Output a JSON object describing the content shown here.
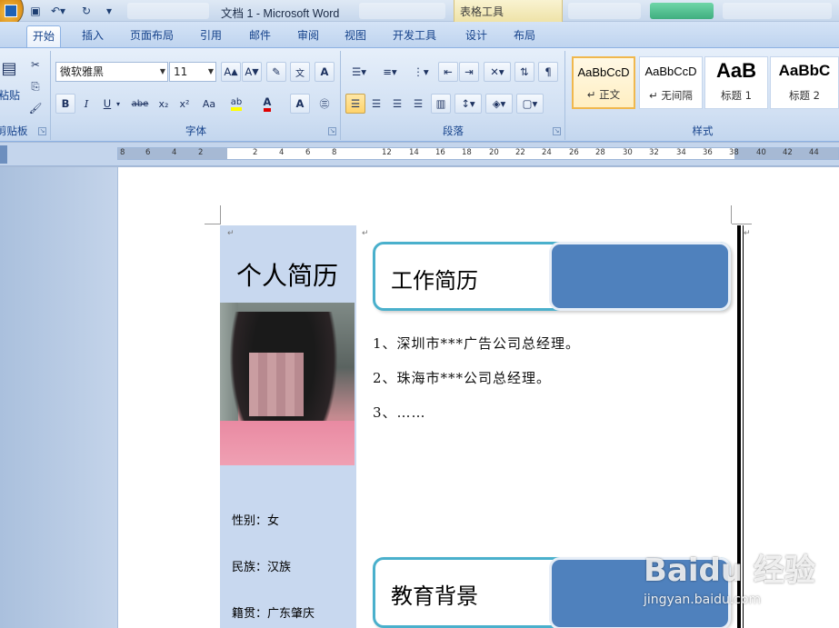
{
  "window": {
    "title": "文档 1 - Microsoft Word",
    "context_tools": "表格工具"
  },
  "tabs": [
    "开始",
    "插入",
    "页面布局",
    "引用",
    "邮件",
    "审阅",
    "视图",
    "开发工具",
    "设计",
    "布局"
  ],
  "active_tab": "开始",
  "ribbon": {
    "clipboard": {
      "paste_label": "粘贴",
      "group_label": "剪贴板"
    },
    "font": {
      "font_name": "微软雅黑",
      "font_size": "11",
      "group_label": "字体",
      "buttons": [
        "B",
        "I",
        "U",
        "abe",
        "x₂",
        "x²",
        "Aa"
      ]
    },
    "paragraph": {
      "group_label": "段落"
    },
    "styles": {
      "group_label": "样式",
      "items": [
        {
          "sample": "AaBbCcD",
          "name": "↵ 正文"
        },
        {
          "sample": "AaBbCcD",
          "name": "↵ 无间隔"
        },
        {
          "sample": "AaB",
          "name": "标题 1"
        },
        {
          "sample": "AaBbC",
          "name": "标题 2"
        }
      ]
    }
  },
  "ruler": {
    "left_numbers": [
      "8",
      "6",
      "4",
      "2"
    ],
    "right_numbers": [
      "2",
      "4",
      "6",
      "8",
      "12",
      "14",
      "16",
      "18",
      "20",
      "22",
      "24",
      "26",
      "28",
      "30",
      "32",
      "34",
      "36",
      "38",
      "40",
      "42",
      "44"
    ]
  },
  "document": {
    "resume_title": "个人简历",
    "work_heading": "工作简历",
    "education_heading": "教育背景",
    "work_items": [
      "1、深圳市***广告公司总经理。",
      "2、珠海市***公司总经理。",
      "3、……"
    ],
    "info": [
      "性别：女",
      "民族：汉族",
      "籍贯：广东肇庆"
    ]
  },
  "watermark": {
    "main": "Baidu 经验",
    "sub": "jingyan.baidu.com"
  }
}
